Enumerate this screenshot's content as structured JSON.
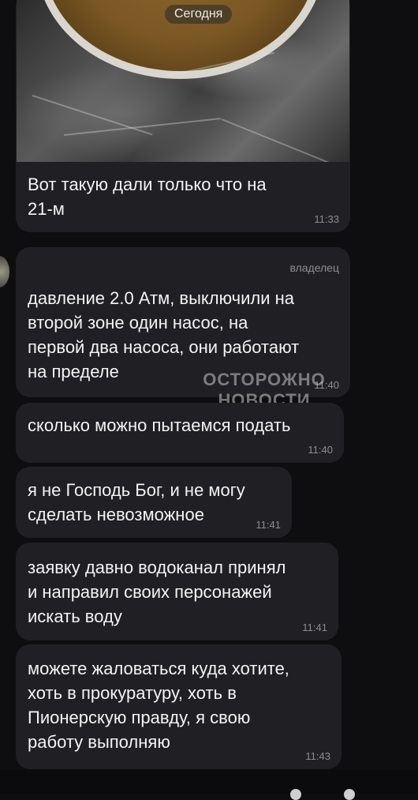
{
  "chat": {
    "date_separator": "Сегодня",
    "sender_label": "владелец",
    "watermark": {
      "line1": "ОСТОРОЖНО",
      "line2": "НОВОСТИ"
    },
    "messages": [
      {
        "text": "Вот такую дали только что на\n21-м",
        "time": "11:33"
      },
      {
        "text": "давление 2.0 Атм, выключили на\nвторой зоне один насос, на\nпервой два насоса, они работают\nна пределе",
        "time": "11:40"
      },
      {
        "text": "сколько можно пытаемся подать",
        "time": "11:40"
      },
      {
        "text": "я не Господь Бог, и не могу\nсделать невозможное",
        "time": "11:41"
      },
      {
        "text": "заявку давно водоканал принял\nи направил своих персонажей\nискать воду",
        "time": "11:41"
      },
      {
        "text": "можете жаловаться куда хотите,\nхоть в прокуратуру, хоть в\nПионерскую правду, я свою\nработу выполняю",
        "time": "11:43"
      }
    ]
  }
}
